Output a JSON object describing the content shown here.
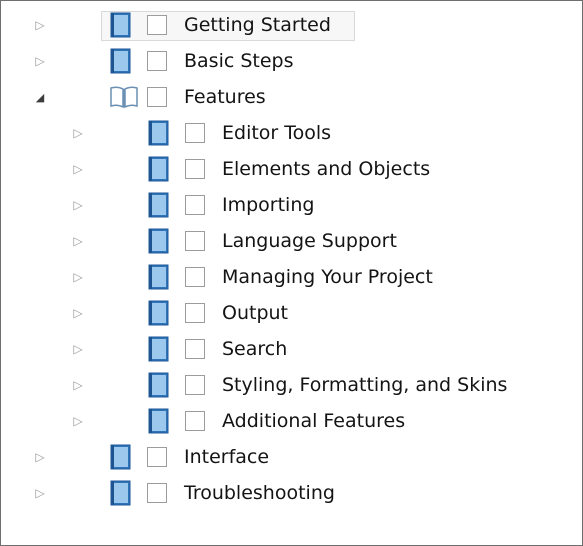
{
  "toc": {
    "items": [
      {
        "label": "Getting Started",
        "level": 0,
        "state": "collapsed",
        "icon": "book-closed-icon",
        "selected": true
      },
      {
        "label": "Basic Steps",
        "level": 0,
        "state": "collapsed",
        "icon": "book-closed-icon"
      },
      {
        "label": "Features",
        "level": 0,
        "state": "expanded",
        "icon": "book-open-icon"
      },
      {
        "label": "Editor Tools",
        "level": 1,
        "state": "collapsed",
        "icon": "book-closed-icon"
      },
      {
        "label": "Elements and Objects",
        "level": 1,
        "state": "collapsed",
        "icon": "book-closed-icon"
      },
      {
        "label": "Importing",
        "level": 1,
        "state": "collapsed",
        "icon": "book-closed-icon"
      },
      {
        "label": "Language Support",
        "level": 1,
        "state": "collapsed",
        "icon": "book-closed-icon"
      },
      {
        "label": "Managing Your Project",
        "level": 1,
        "state": "collapsed",
        "icon": "book-closed-icon"
      },
      {
        "label": "Output",
        "level": 1,
        "state": "collapsed",
        "icon": "book-closed-icon"
      },
      {
        "label": "Search",
        "level": 1,
        "state": "collapsed",
        "icon": "book-closed-icon"
      },
      {
        "label": "Styling, Formatting, and Skins",
        "level": 1,
        "state": "collapsed",
        "icon": "book-closed-icon"
      },
      {
        "label": "Additional Features",
        "level": 1,
        "state": "collapsed",
        "icon": "book-closed-icon"
      },
      {
        "label": "Interface",
        "level": 0,
        "state": "collapsed",
        "icon": "book-closed-icon"
      },
      {
        "label": "Troubleshooting",
        "level": 0,
        "state": "collapsed",
        "icon": "book-closed-icon"
      }
    ]
  },
  "colors": {
    "book_blue": "#2f73b8",
    "book_light": "#9cc8ee",
    "book_open_outline": "#6c8fb4"
  }
}
